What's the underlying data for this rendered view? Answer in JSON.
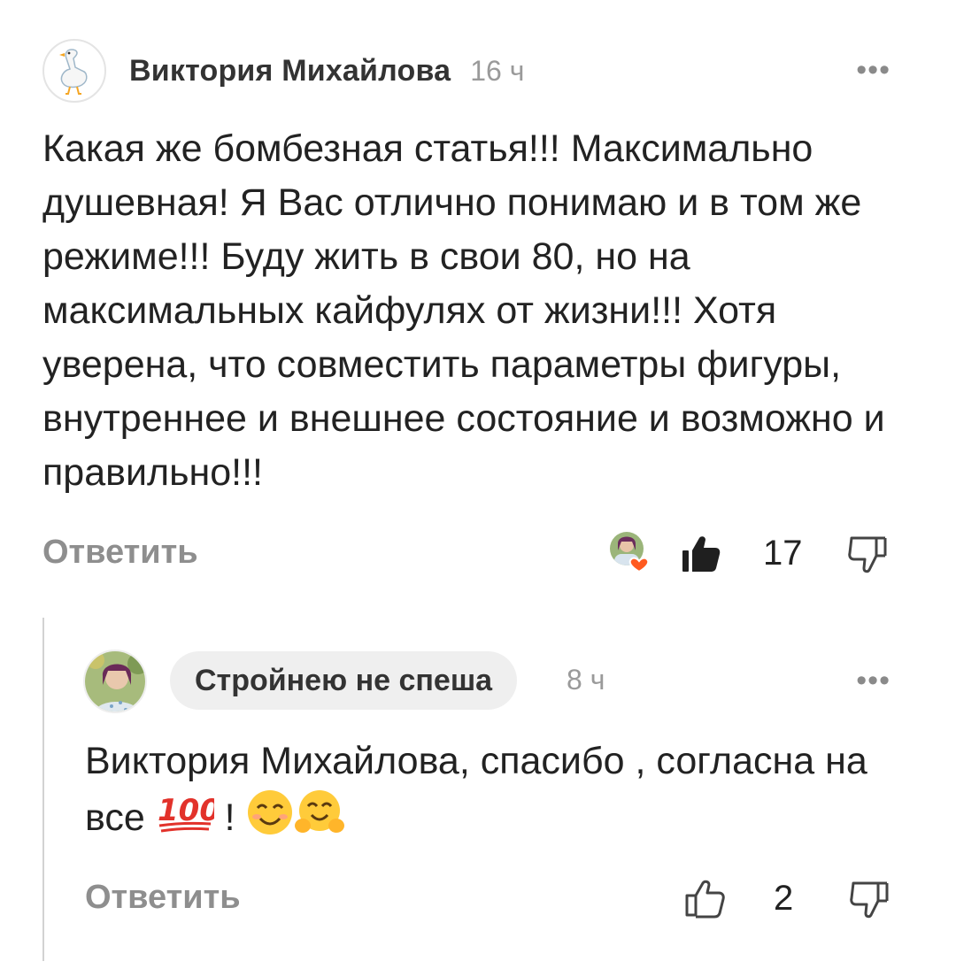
{
  "comment1": {
    "author": "Виктория Михайлова",
    "time": "16 ч",
    "more": "•••",
    "avatar_icon": "goose-icon",
    "text": "Какая же бомбезная статья!!! Максимально душевная! Я Вас отлично понимаю и в том же режиме!!! Буду жить в свои 80, но на максимальных кайфулях от жизни!!! Хотя уверена, что совместить параметры фигуры, внутреннее и внешнее состояние и возможно и правильно!!!",
    "reply_label": "Ответить",
    "like_count": "17",
    "liked": true
  },
  "comment2": {
    "author": "Стройнею не спеша",
    "time": "8 ч",
    "more": "•••",
    "text_main": "Виктория Михайлова, спасибо , согласна на все",
    "text_exclaim": " ! ",
    "emojis": [
      "hundred-points",
      "smiling-face",
      "hugging-face"
    ],
    "reply_label": "Ответить",
    "like_count": "2",
    "liked": false
  },
  "colors": {
    "heart_badge": "#ff5a1f",
    "text": "#222222",
    "muted": "#8e8e8e",
    "pill_bg": "#efefef"
  }
}
